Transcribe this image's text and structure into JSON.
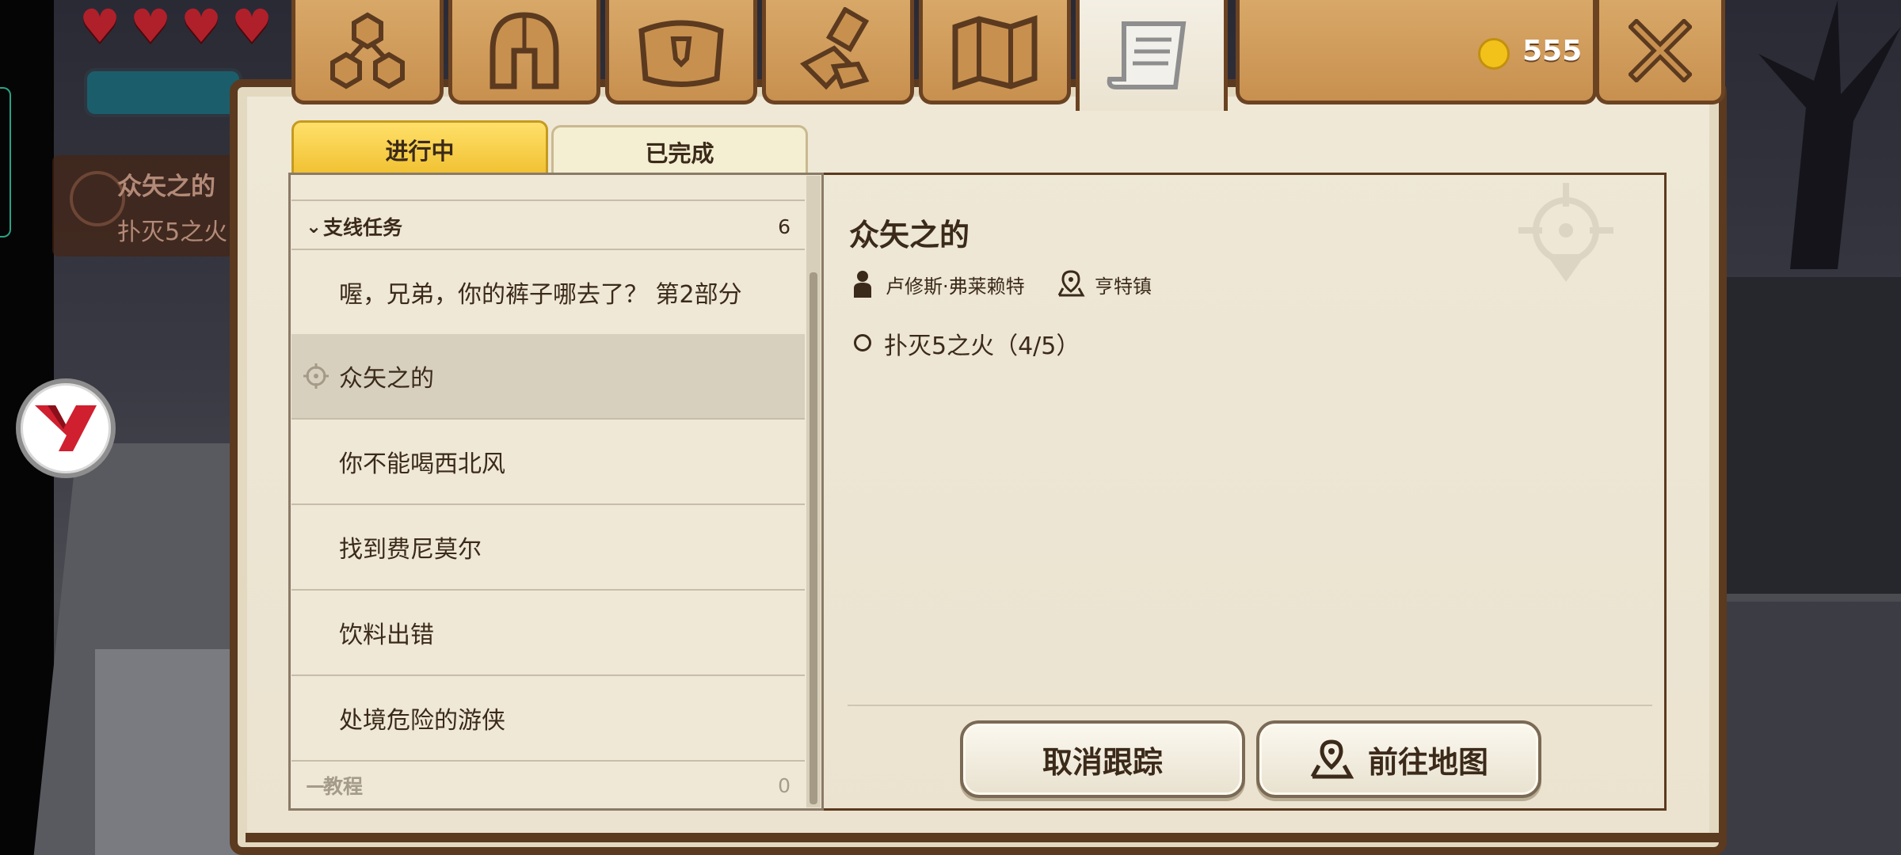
{
  "hud": {
    "hearts": [
      "♥",
      "♥",
      "♥",
      "♥"
    ],
    "tracked_quest_title": "众矢之的",
    "tracked_quest_sub": "扑灭5之火"
  },
  "top_tabs": [
    {
      "icon": "skill-tree-icon"
    },
    {
      "icon": "helmet-icon"
    },
    {
      "icon": "bag-icon"
    },
    {
      "icon": "craft-hammer-icon"
    },
    {
      "icon": "map-icon"
    },
    {
      "icon": "quest-scroll-icon",
      "active": true
    }
  ],
  "gold": {
    "amount": "555"
  },
  "status_tabs": {
    "in_progress": "进行中",
    "completed": "已完成"
  },
  "quest_list": {
    "sections": [
      {
        "label": "支线任务",
        "count": "6",
        "arrow": "⌄"
      },
      {
        "label": "教程",
        "count": "0",
        "arrow": "—"
      }
    ],
    "items": [
      "喔，兄弟，你的裤子哪去了？ 第2部分",
      "众矢之的",
      "你不能喝西北风",
      "找到费尼莫尔",
      "饮料出错",
      "处境危险的游侠"
    ]
  },
  "detail": {
    "title": "众矢之的",
    "giver": "卢修斯·弗莱赖特",
    "location": "亨特镇",
    "objective": "扑灭5之火（4/5）"
  },
  "actions": {
    "untrack": "取消跟踪",
    "go_to_map": "前往地图"
  },
  "colors": {
    "tab_wood": "#c8904f",
    "tab_border": "#6b4322",
    "active_tab_yellow": "#f0c030",
    "text_dark": "#3b2a1a",
    "coin": "#f2c21a"
  }
}
